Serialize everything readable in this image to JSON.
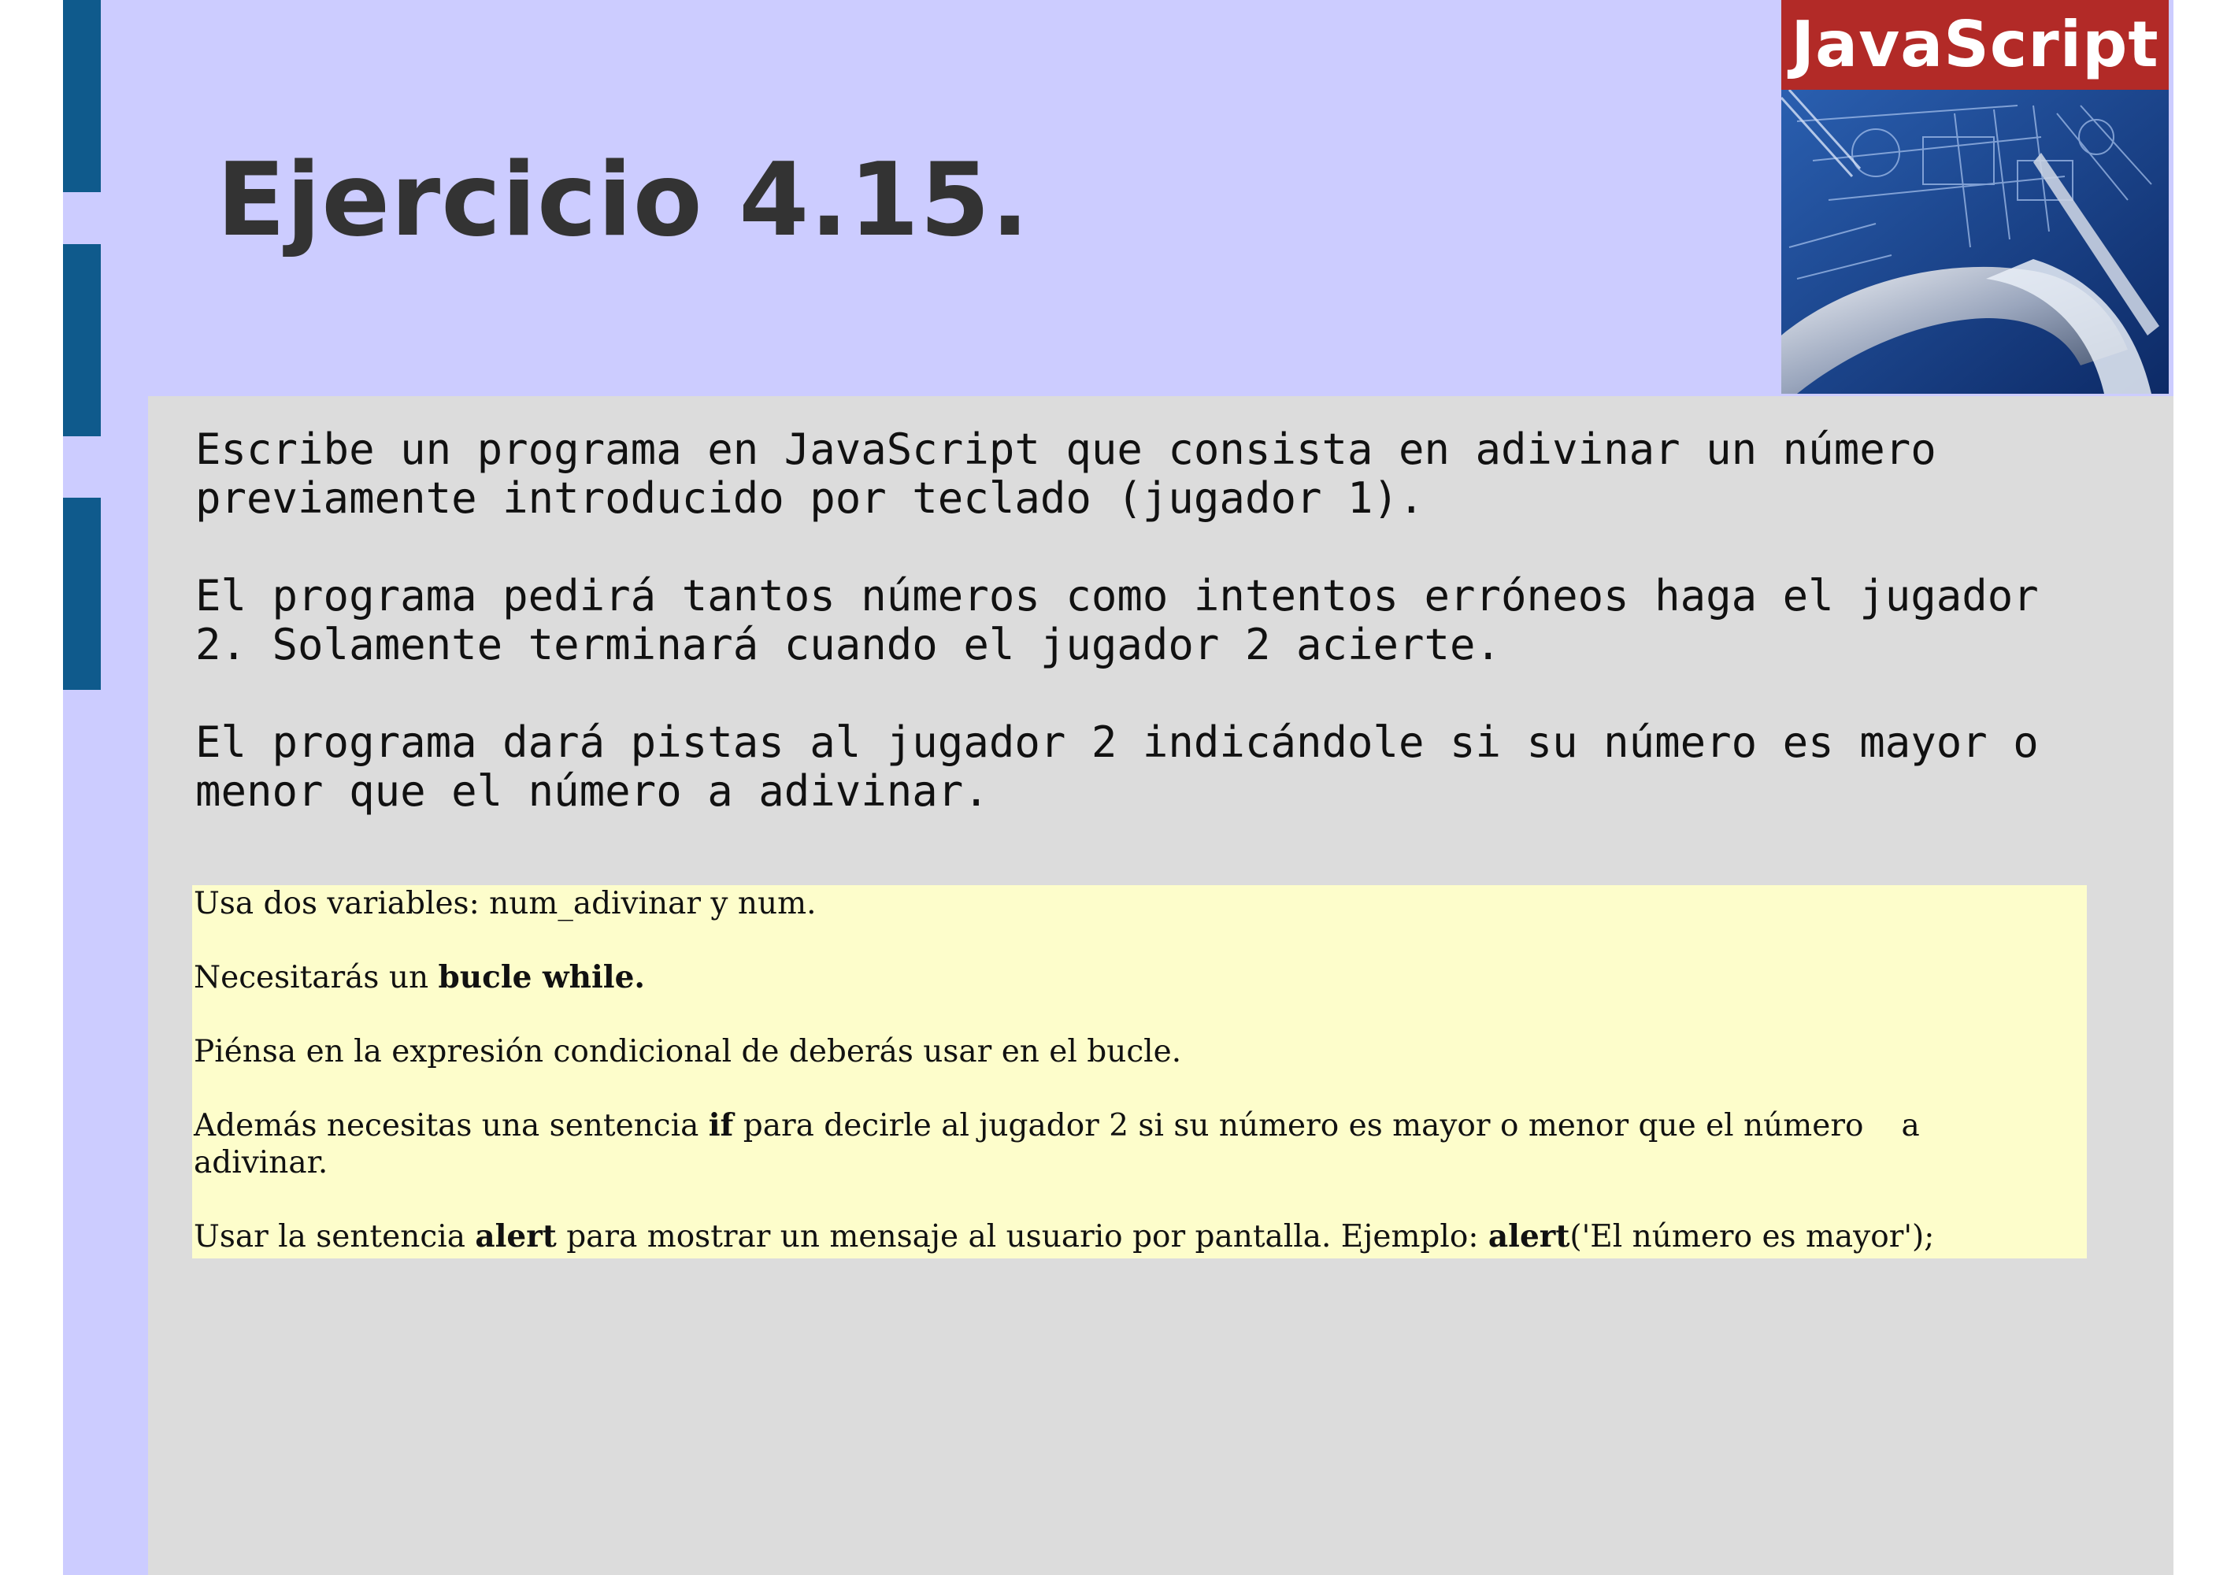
{
  "slide": {
    "title": "Ejercicio 4.15.",
    "logo_text": "JavaScript"
  },
  "body": {
    "paragraphs": [
      {
        "line1": "Escribe un programa en JavaScript que consista en adivinar un número",
        "line2": "previamente introducido por teclado (jugador 1)."
      },
      {
        "line1": "El programa pedirá tantos números como intentos erróneos haga el jugador",
        "line2": "2. Solamente terminará cuando el jugador 2 acierte."
      },
      {
        "line1": "El programa dará pistas al jugador 2 indicándole si su número es mayor o",
        "line2": "menor que el número a adivinar."
      }
    ]
  },
  "hints": {
    "variables": "Usa dos variables: num_adivinar y num.",
    "while_prefix": "Necesitarás un ",
    "while_bold": "bucle while.",
    "condition": "Piénsa en la expresión condicional de deberás usar en el bucle.",
    "if_prefix": "Además necesitas una sentencia ",
    "if_bold": "if",
    "if_suffix": " para decirle al jugador 2 si su número es mayor o menor que el número",
    "if_tail": "a",
    "if_line2": "adivinar.",
    "alert_prefix": "Usar la sentencia ",
    "alert_bold": "alert",
    "alert_middle": " para mostrar un mensaje al usuario por pantalla. Ejemplo: ",
    "alert_bold2": "alert",
    "alert_suffix": "('El número es mayor');"
  },
  "colors": {
    "slide_background": "#ccccff",
    "side_bars": "#0f5a8c",
    "content_panel": "#dcdcdc",
    "hint_box": "#fdfdcb",
    "logo_banner": "#b22a27"
  }
}
